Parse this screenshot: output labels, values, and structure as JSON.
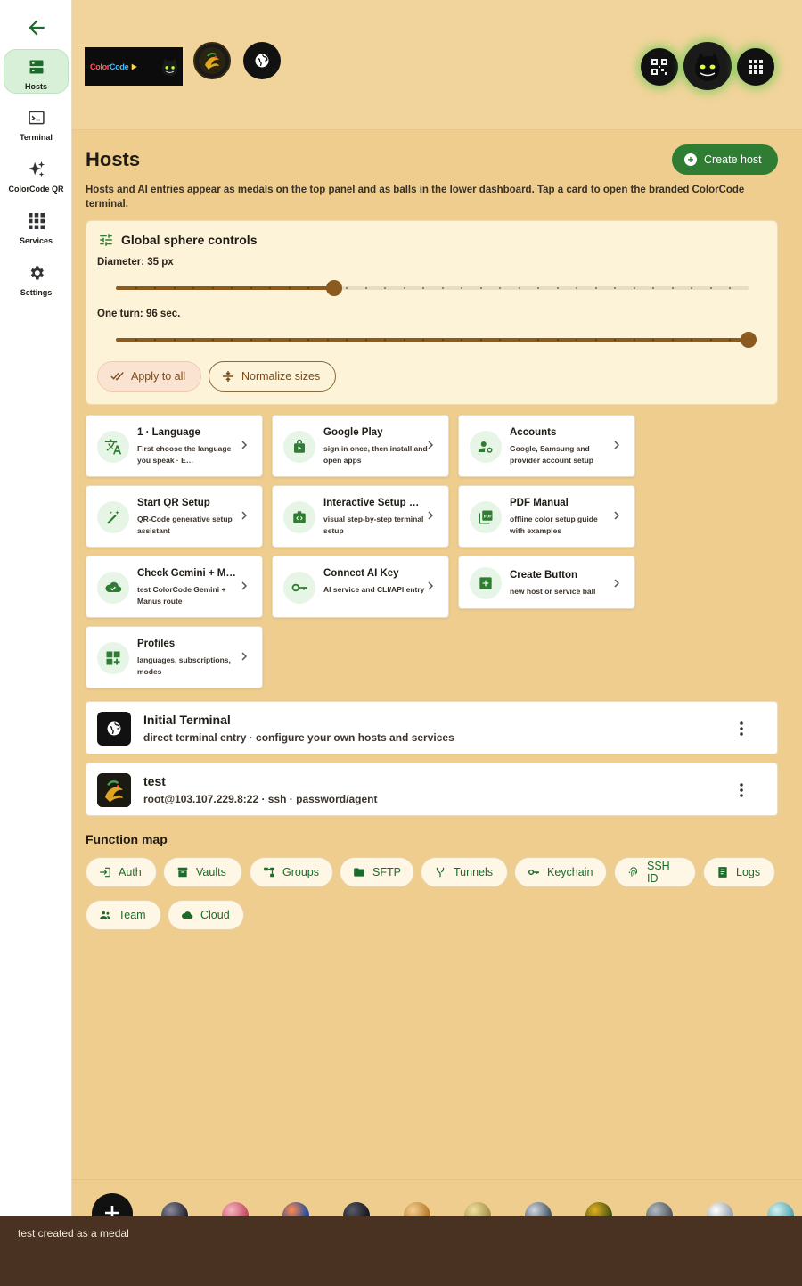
{
  "sidebar": {
    "back_icon": "arrow-left-icon",
    "items": [
      {
        "label": "Hosts",
        "icon": "hosts-icon",
        "active": true
      },
      {
        "label": "Terminal",
        "icon": "terminal-icon",
        "active": false
      },
      {
        "label": "ColorCode QR",
        "icon": "sparkles-icon",
        "active": false
      },
      {
        "label": "Services",
        "icon": "grid-icon",
        "active": false
      },
      {
        "label": "Settings",
        "icon": "gear-icon",
        "active": false
      }
    ]
  },
  "top_panel": {
    "logo_text_a": "Color",
    "logo_text_b": "Code",
    "medals": [
      "colorcode-logo-medal",
      "dragon-medal",
      "globe-medal"
    ],
    "right_medals": [
      "qr-medal",
      "cat-medal",
      "apps-medal"
    ]
  },
  "header": {
    "title": "Hosts",
    "create_button": "Create host",
    "intro": "Hosts and AI entries appear as medals on the top panel and as balls in the lower dashboard. Tap a card to open the branded ColorCode terminal."
  },
  "sphere_controls": {
    "title": "Global sphere controls",
    "diameter_label": "Diameter: 35 px",
    "diameter_fraction": 0.345,
    "turn_label": "One turn: 96 sec.",
    "turn_fraction": 1.0,
    "apply_button": "Apply to all",
    "normalize_button": "Normalize sizes"
  },
  "cards": [
    {
      "title": "1 · Language",
      "sub": "First choose the language you speak · E…",
      "icon": "translate-icon"
    },
    {
      "title": "Google Play",
      "sub": "sign in once, then install and open apps",
      "icon": "store-icon"
    },
    {
      "title": "Accounts",
      "sub": "Google, Samsung and provider account setup",
      "icon": "account-settings-icon"
    },
    {
      "title": "Start QR Setup",
      "sub": "QR-Code generative setup assistant",
      "icon": "magic-wand-icon"
    },
    {
      "title": "Interactive Setup …",
      "sub": "visual step-by-step terminal setup",
      "icon": "code-badge-icon"
    },
    {
      "title": "PDF Manual",
      "sub": "offline color setup guide with examples",
      "icon": "pdf-icon"
    },
    {
      "title": "Check Gemini + M…",
      "sub": "test ColorCode Gemini + Manus route",
      "icon": "cloud-check-icon"
    },
    {
      "title": "Connect AI Key",
      "sub": "AI service and CLI/API entry",
      "icon": "key-icon"
    },
    {
      "title": "Create Button",
      "sub": "new host or service ball",
      "icon": "add-box-icon"
    },
    {
      "title": "Profiles",
      "sub": "languages, subscriptions, modes",
      "icon": "dashboard-add-icon"
    }
  ],
  "hosts": [
    {
      "title": "Initial Terminal",
      "sub": "direct terminal entry · configure your own hosts and services",
      "icon": "globe-icon"
    },
    {
      "title": "test",
      "sub": "root@103.107.229.8:22 · ssh · password/agent",
      "icon": "dragon-icon"
    }
  ],
  "function_map": {
    "title": "Function map",
    "chips": [
      {
        "label": "Auth",
        "icon": "login-icon"
      },
      {
        "label": "Vaults",
        "icon": "archive-icon"
      },
      {
        "label": "Groups",
        "icon": "tree-icon"
      },
      {
        "label": "SFTP",
        "icon": "folder-icon"
      },
      {
        "label": "Tunnels",
        "icon": "fork-icon"
      },
      {
        "label": "Keychain",
        "icon": "key-icon"
      },
      {
        "label": "SSH ID",
        "icon": "fingerprint-icon"
      },
      {
        "label": "Logs",
        "icon": "receipt-icon"
      },
      {
        "label": "Team",
        "icon": "group-icon"
      },
      {
        "label": "Cloud",
        "icon": "cloud-icon"
      }
    ]
  },
  "snackbar": {
    "message": "test created as a medal"
  },
  "colors": {
    "accent": "#2e7d32",
    "slider": "#8a5a1e",
    "background": "#eecd8e",
    "snackbar": "#4a3222"
  }
}
